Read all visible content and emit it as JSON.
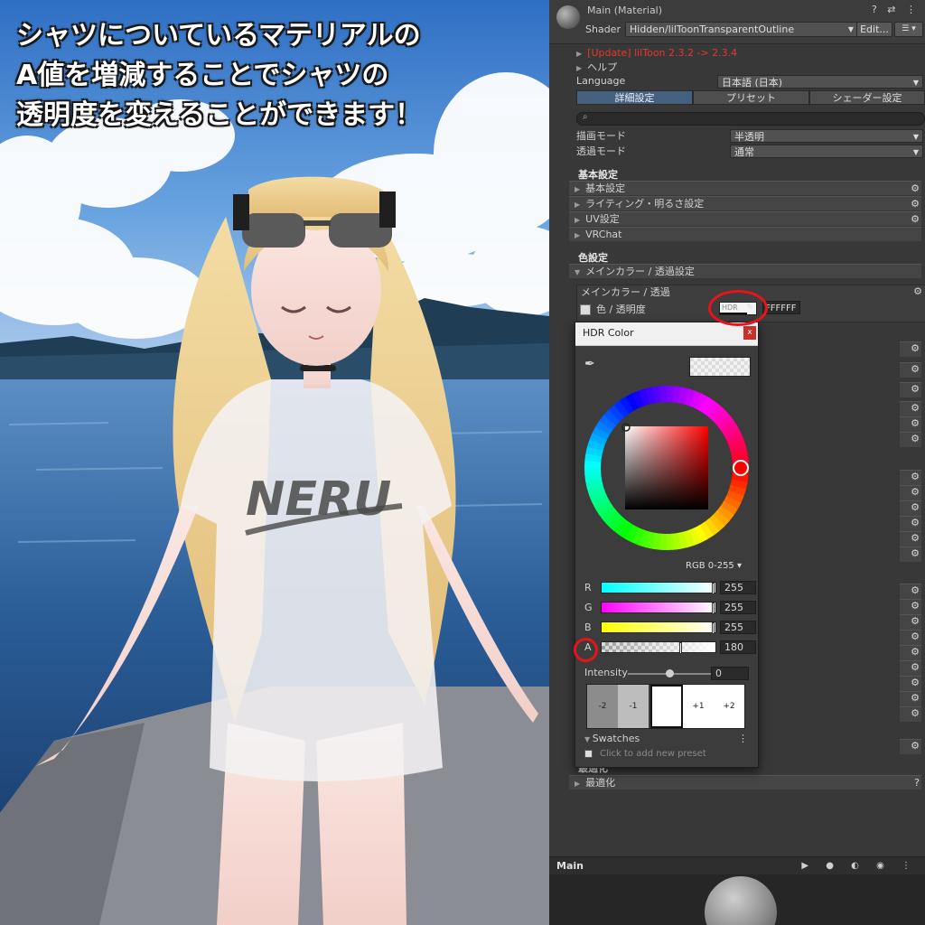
{
  "caption": {
    "line1": "シャツについているマテリアルの",
    "line2": "A値を増減することでシャツの",
    "line3": "透明度を変えることができます！"
  },
  "scene": {
    "shirt_text": "NERU"
  },
  "inspector": {
    "material_title": "Main (Material)",
    "header_icons": "? ⇄ ⋮",
    "shader_label": "Shader",
    "shader_value": "Hidden/lilToonTransparentOutline",
    "edit_label": "Edit...",
    "list_label": "☰ ▾",
    "update_text": "[Update] lilToon 2.3.2 -> 2.3.4",
    "help_label": "ヘルプ",
    "language_label": "Language",
    "language_value": "日本語 (日本)",
    "tabs": [
      "詳細設定",
      "プリセット",
      "シェーダー設定"
    ],
    "render_mode_label": "描画モード",
    "render_mode_value": "半透明",
    "transparent_mode_label": "透過モード",
    "transparent_mode_value": "通常",
    "basic_section": "基本設定",
    "basic_folds": [
      "基本設定",
      "ライティング・明るさ設定",
      "UV設定",
      "VRChat"
    ],
    "color_section": "色設定",
    "main_color_fold": "メインカラー / 透過設定",
    "main_color_box": "メインカラー / 透過",
    "color_row_label": "色 / 透明度",
    "hdr_tag": "HDR",
    "hex_value": "FFFFFF",
    "optimize_section": "最適化",
    "optimize_fold": "最適化",
    "bottom_bar_label": "Main"
  },
  "popup": {
    "title": "HDR Color",
    "close_label": "x",
    "mode": "RGB 0-255 ▾",
    "channels": [
      {
        "name": "R",
        "value": "255"
      },
      {
        "name": "G",
        "value": "255"
      },
      {
        "name": "B",
        "value": "255"
      },
      {
        "name": "A",
        "value": "180"
      }
    ],
    "alpha_fraction": 0.706,
    "intensity_label": "Intensity",
    "intensity_value": "0",
    "presets": [
      "-2",
      "-1",
      "",
      "+1",
      "+2"
    ],
    "swatches_label": "Swatches",
    "add_preset": "Click to add new preset"
  },
  "colors": {
    "highlight_ring": "#e8141c",
    "update_text": "#e23a2a",
    "active_tab": "#46607f"
  }
}
